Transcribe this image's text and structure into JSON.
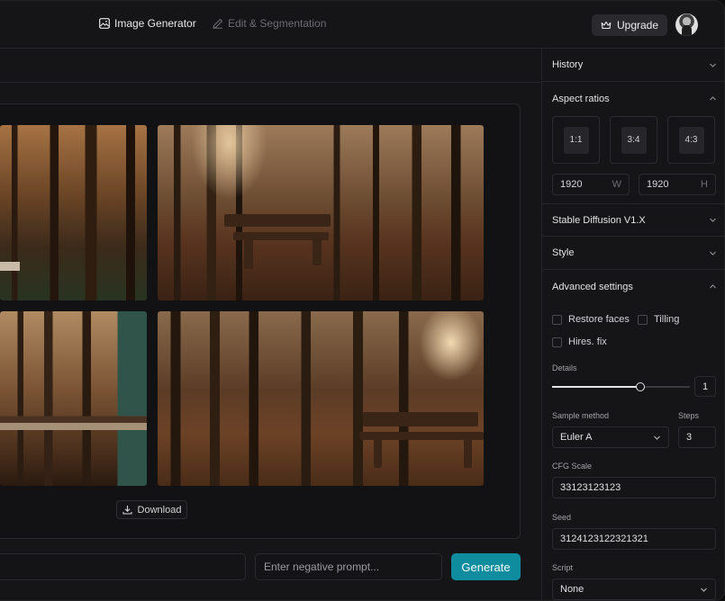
{
  "header": {
    "nav": [
      {
        "label": "Image Generator",
        "icon": "image-icon",
        "active": true
      },
      {
        "label": "Edit & Segmentation",
        "icon": "pencil-icon",
        "active": false
      }
    ],
    "upgrade_label": "Upgrade"
  },
  "gallery": {
    "images": [
      {
        "name": "forest-image-1"
      },
      {
        "name": "forest-bench-image-2"
      },
      {
        "name": "forest-bench-image-3"
      },
      {
        "name": "forest-bench-image-4"
      }
    ],
    "download_label": "Download"
  },
  "prompt": {
    "prompt_value": "",
    "negative_placeholder": "Enter negative prompt...",
    "generate_label": "Generate"
  },
  "panel": {
    "history": {
      "title": "History"
    },
    "aspect": {
      "title": "Aspect ratios",
      "ratios": [
        "1:1",
        "3:4",
        "4:3"
      ],
      "width": "1920",
      "width_unit": "W",
      "height": "1920",
      "height_unit": "H"
    },
    "model": {
      "title": "Stable Diffusion V1.X"
    },
    "style": {
      "title": "Style"
    },
    "advanced": {
      "title": "Advanced settings",
      "restore_faces": "Restore faces",
      "tilling": "Tilling",
      "hires_fix": "Hires. fix",
      "details_label": "Details",
      "details_value": "1",
      "details_slider_fraction": 0.64,
      "sample_method_label": "Sample method",
      "sample_method_value": "Euler A",
      "steps_label": "Steps",
      "steps_value": "3",
      "cfg_label": "CFG Scale",
      "cfg_value": "33123123123",
      "seed_label": "Seed",
      "seed_value": "3124123122321321",
      "script_label": "Script",
      "script_value": "None"
    }
  },
  "colors": {
    "accent": "#108c9f",
    "background": "#151517"
  }
}
